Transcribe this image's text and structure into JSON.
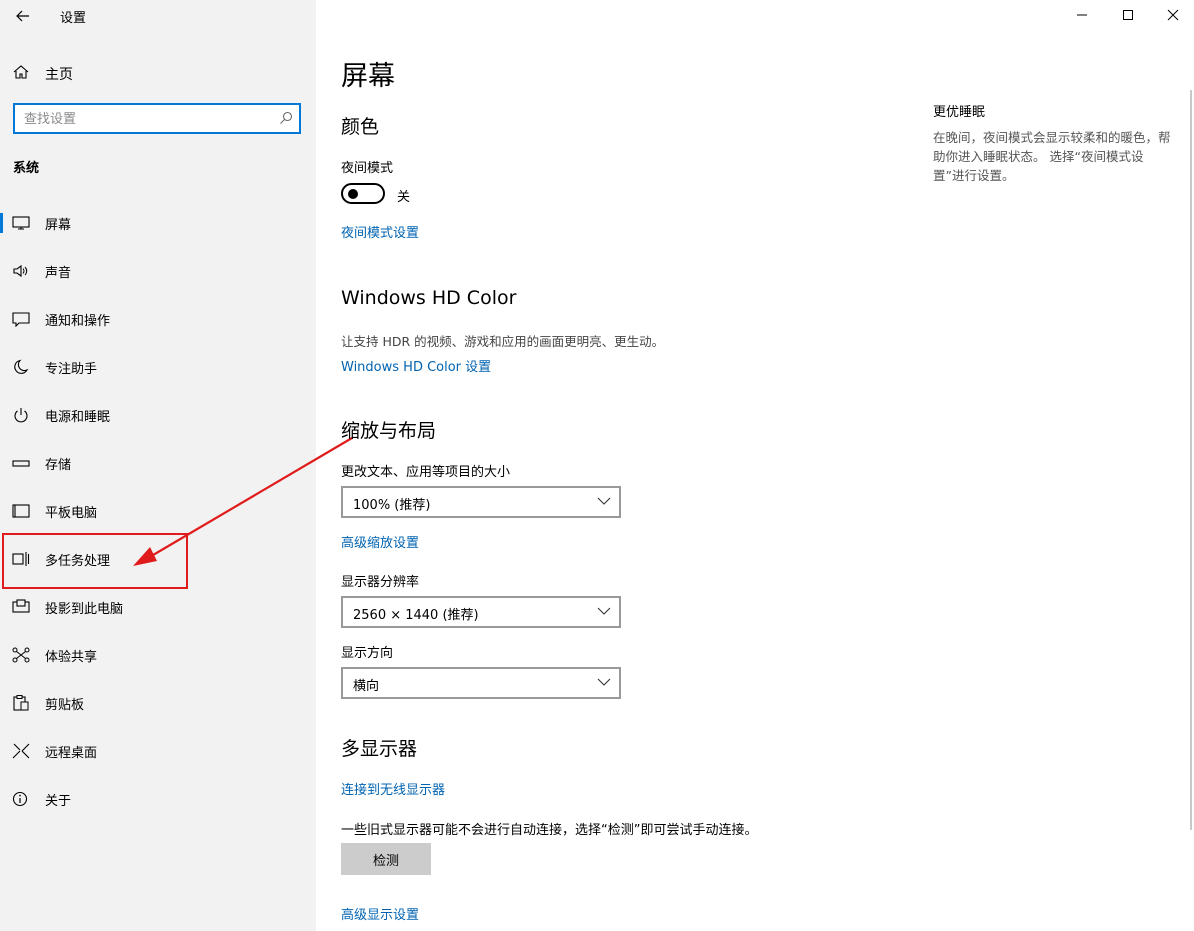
{
  "window": {
    "title": "设置",
    "icons": {
      "back": "back-arrow-icon",
      "minimize": "minimize-icon",
      "maximize": "maximize-icon",
      "close": "close-icon"
    }
  },
  "sidebar": {
    "home_label": "主页",
    "search_placeholder": "查找设置",
    "section_label": "系统",
    "items": [
      {
        "label": "屏幕",
        "icon": "monitor-icon",
        "active": true
      },
      {
        "label": "声音",
        "icon": "speaker-icon"
      },
      {
        "label": "通知和操作",
        "icon": "notification-icon"
      },
      {
        "label": "专注助手",
        "icon": "moon-icon"
      },
      {
        "label": "电源和睡眠",
        "icon": "power-icon"
      },
      {
        "label": "存储",
        "icon": "storage-icon"
      },
      {
        "label": "平板电脑",
        "icon": "tablet-icon"
      },
      {
        "label": "多任务处理",
        "icon": "multitask-icon"
      },
      {
        "label": "投影到此电脑",
        "icon": "project-icon"
      },
      {
        "label": "体验共享",
        "icon": "share-icon"
      },
      {
        "label": "剪贴板",
        "icon": "clipboard-icon"
      },
      {
        "label": "远程桌面",
        "icon": "remote-desktop-icon"
      },
      {
        "label": "关于",
        "icon": "info-icon"
      }
    ]
  },
  "main": {
    "title": "屏幕",
    "color": {
      "heading": "颜色",
      "night_mode_label": "夜间模式",
      "night_mode_state": "关",
      "night_mode_settings_link": "夜间模式设置"
    },
    "hdr": {
      "heading": "Windows HD Color",
      "description": "让支持 HDR 的视频、游戏和应用的画面更明亮、更生动。",
      "link": "Windows HD Color 设置"
    },
    "scale": {
      "heading": "缩放与布局",
      "size_label": "更改文本、应用等项目的大小",
      "size_value": "100% (推荐)",
      "advanced_link": "高级缩放设置",
      "resolution_label": "显示器分辨率",
      "resolution_value": "2560 × 1440 (推荐)",
      "orientation_label": "显示方向",
      "orientation_value": "横向"
    },
    "multi": {
      "heading": "多显示器",
      "wireless_link": "连接到无线显示器",
      "description": "一些旧式显示器可能不会进行自动连接，选择“检测”即可尝试手动连接。",
      "detect_button": "检测",
      "advanced_link": "高级显示设置"
    }
  },
  "aside": {
    "title": "更优睡眠",
    "text": "在晚间，夜间模式会显示较柔和的暖色，帮助你进入睡眠状态。 选择“夜间模式设置”进行设置。"
  },
  "annotation": {
    "color": "#e01b1b"
  },
  "colors": {
    "accent": "#0078d7",
    "link": "#0063b1"
  }
}
